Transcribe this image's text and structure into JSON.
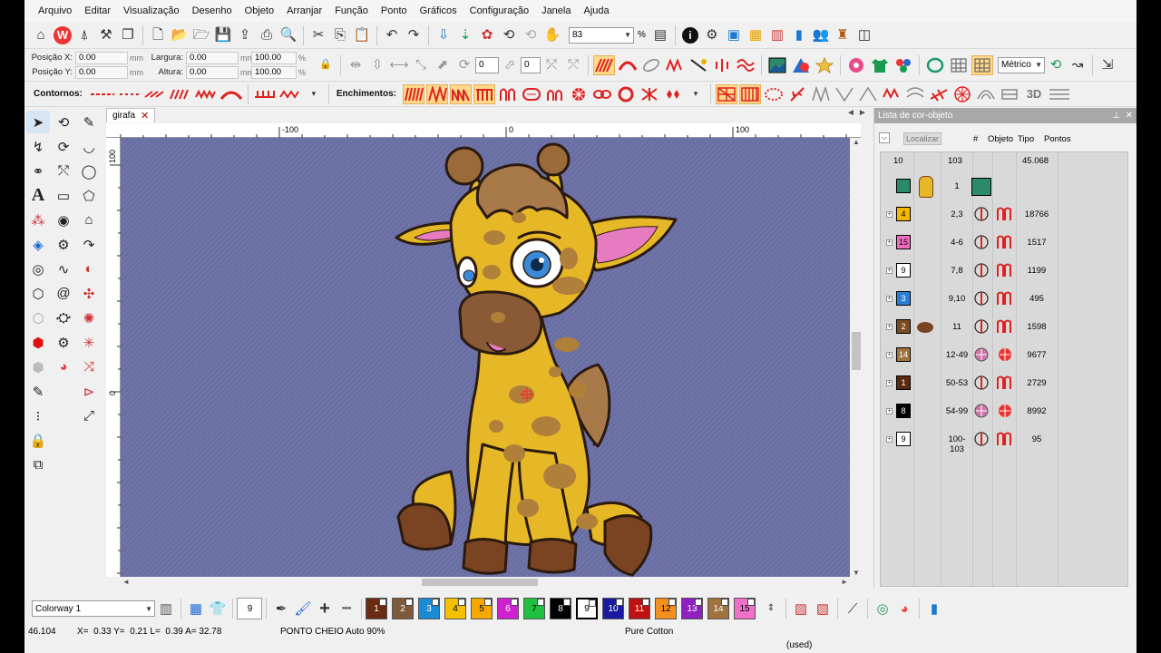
{
  "menu": [
    "Arquivo",
    "Editar",
    "Visualização",
    "Desenho",
    "Objeto",
    "Arranjar",
    "Função",
    "Ponto",
    "Gráficos",
    "Configuração",
    "Janela",
    "Ajuda"
  ],
  "toolbar": {
    "zoom_value": "83",
    "zoom_unit": "%"
  },
  "position": {
    "x_label": "Posição X:",
    "x_value": "0.00",
    "x_unit": "mm",
    "y_label": "Posição Y:",
    "y_value": "0.00",
    "y_unit": "mm",
    "width_label": "Largura:",
    "width_value": "0.00",
    "width_unit": "mm",
    "height_label": "Altura:",
    "height_value": "0.00",
    "height_unit": "mm",
    "width_pct": "100.00",
    "height_pct": "100.00",
    "pct_unit": "%",
    "rotate_value": "0",
    "slant_value": "0"
  },
  "units_select": "Métrico",
  "contours_label": "Contornos:",
  "fills_label": "Enchimentos:",
  "label_3d": "3D",
  "document": {
    "tab": "girafa",
    "nav_left": "◄",
    "nav_right": "►"
  },
  "rulers": {
    "top": [
      "-100",
      "0",
      "100"
    ],
    "left": [
      "100",
      "0"
    ]
  },
  "panel": {
    "title": "Lista de cor-objeto",
    "locate": "Localizar",
    "headers": {
      "num": "#",
      "object": "Objeto",
      "type": "Tipo",
      "points": "Pontos"
    },
    "summary": {
      "colors": "10",
      "objects": "103",
      "points": "45.068"
    },
    "rows": [
      {
        "swatch": "",
        "color": "#2a8a6a",
        "range": "1",
        "points": ""
      },
      {
        "swatch": "4",
        "color": "#f5b800",
        "range": "2,3",
        "points": "18766"
      },
      {
        "swatch": "15",
        "color": "#f06bc0",
        "range": "4-6",
        "points": "1517"
      },
      {
        "swatch": "9",
        "color": "#ffffff",
        "range": "7,8",
        "points": "1199"
      },
      {
        "swatch": "3",
        "color": "#2a7fd4",
        "range": "9,10",
        "points": "495"
      },
      {
        "swatch": "2",
        "color": "#7a4a20",
        "range": "11",
        "points": "1598"
      },
      {
        "swatch": "14",
        "color": "#a07240",
        "range": "12-49",
        "points": "9677"
      },
      {
        "swatch": "1",
        "color": "#5a2a10",
        "range": "50-53",
        "points": "2729"
      },
      {
        "swatch": "8",
        "color": "#000000",
        "range": "54-99",
        "points": "8992"
      },
      {
        "swatch": "9",
        "color": "#ffffff",
        "range": "100-103",
        "points": "95"
      }
    ]
  },
  "colorbar": {
    "colorway": "Colorway 1",
    "stitch_count_box": "9",
    "chips": [
      {
        "n": "1",
        "color": "#6b2a12",
        "text": "#ffffff"
      },
      {
        "n": "2",
        "color": "#7d5a3c",
        "text": "#ffffff"
      },
      {
        "n": "3",
        "color": "#1a8ad6",
        "text": "#ffffff"
      },
      {
        "n": "4",
        "color": "#f5c000",
        "text": "#000000"
      },
      {
        "n": "5",
        "color": "#f5a800",
        "text": "#000000"
      },
      {
        "n": "6",
        "color": "#d020d0",
        "text": "#ffffff"
      },
      {
        "n": "7",
        "color": "#20c040",
        "text": "#000000"
      },
      {
        "n": "8",
        "color": "#000000",
        "text": "#ffffff"
      },
      {
        "n": "9",
        "color": "#ffffff",
        "text": "#000000"
      },
      {
        "n": "10",
        "color": "#1a1aa0",
        "text": "#ffffff"
      },
      {
        "n": "11",
        "color": "#c01010",
        "text": "#ffffff"
      },
      {
        "n": "12",
        "color": "#f59020",
        "text": "#000000"
      },
      {
        "n": "13",
        "color": "#9020c0",
        "text": "#ffffff"
      },
      {
        "n": "14",
        "color": "#a07240",
        "text": "#ffffff"
      },
      {
        "n": "15",
        "color": "#f070c8",
        "text": "#000000"
      }
    ]
  },
  "status": {
    "count": "46.104",
    "coords": "X=  0.33 Y=  0.21 L=  0.39 A= 32.78",
    "stitch_type": "PONTO CHEIO Auto 90%",
    "thread": "Pure Cotton",
    "used": "(used)"
  },
  "colors": {
    "canvas": "#6a6fa3",
    "giraffe_body": "#e6b726",
    "giraffe_spots": "#b0803a",
    "giraffe_outline": "#2a1a10",
    "ear_inner": "#e77bc0",
    "hoof": "#7a4423",
    "eye": "#3a8ad8"
  }
}
